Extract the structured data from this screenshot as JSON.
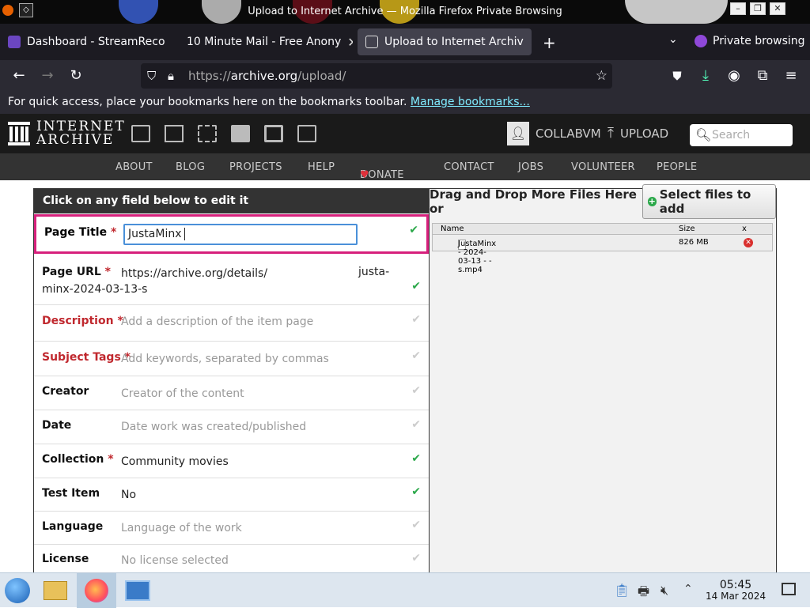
{
  "window": {
    "title": "Upload to Internet Archive — Mozilla Firefox Private Browsing"
  },
  "tabs": [
    {
      "label": "Dashboard - StreamReco",
      "active": false
    },
    {
      "label": "10 Minute Mail - Free Anony",
      "active": false
    },
    {
      "label": "Upload to Internet Archiv",
      "active": true
    }
  ],
  "private_label": "Private browsing",
  "url": {
    "prefix": "https://",
    "domain": "archive.org",
    "path": "/upload/"
  },
  "bookmarks_bar": {
    "text": "For quick access, place your bookmarks here on the bookmarks toolbar.",
    "link": "Manage bookmarks..."
  },
  "ia_header": {
    "logo_line1": "INTERNET",
    "logo_line2": "ARCHIVE",
    "account": "COLLABVM",
    "upload": "UPLOAD",
    "search_placeholder": "Search"
  },
  "ia_nav": [
    "ABOUT",
    "BLOG",
    "PROJECTS",
    "HELP",
    "DONATE",
    "CONTACT",
    "JOBS",
    "VOLUNTEER",
    "PEOPLE"
  ],
  "form": {
    "header": "Click on any field below to edit it",
    "title_label": "Page Title",
    "title_value": "JustaMinx",
    "url_label": "Page URL",
    "url_value_1": "https://archive.org/details/",
    "url_value_2": "justa-",
    "url_value_3": "minx-2024-03-13-s",
    "description_label": "Description",
    "description_placeholder": "Add a description of the item page",
    "subject_label": "Subject Tags",
    "subject_placeholder": "Add keywords, separated by commas",
    "creator_label": "Creator",
    "creator_placeholder": "Creator of the content",
    "date_label": "Date",
    "date_placeholder": "Date work was created/published",
    "collection_label": "Collection",
    "collection_value": "Community movies",
    "test_label": "Test Item",
    "test_value": "No",
    "language_label": "Language",
    "language_placeholder": "Language of the work",
    "license_label": "License",
    "license_placeholder": "No license selected",
    "required_mark": "*",
    "check": "✔"
  },
  "files": {
    "header": "Drag and Drop More Files Here or",
    "select_button": "Select files to add",
    "columns": [
      "Name",
      "Size",
      "x"
    ],
    "rows": [
      {
        "name": "JustaMinx - 2024-03-13 - - s.mp4",
        "size": "826 MB"
      }
    ]
  },
  "taskbar": {
    "time": "05:45",
    "date": "14 Mar 2024"
  }
}
